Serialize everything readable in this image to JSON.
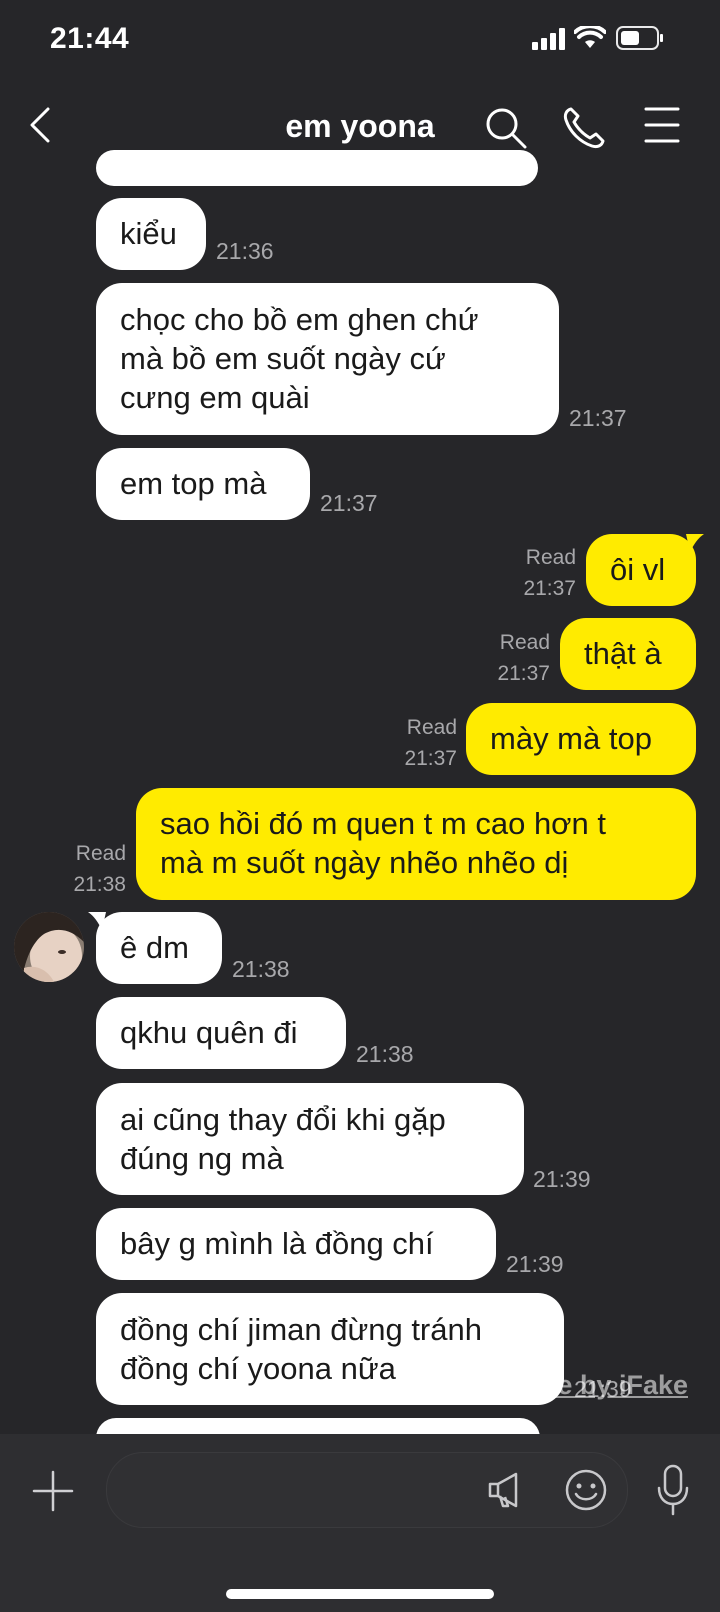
{
  "status_bar": {
    "time": "21:44"
  },
  "header": {
    "title": "em yoona"
  },
  "messages": [
    {
      "text": "kiểu",
      "time": "21:36"
    },
    {
      "text": "chọc cho bồ em ghen chứ\nmà bồ em suốt ngày cứ\ncưng em quài",
      "time": "21:37"
    },
    {
      "text": "em top mà",
      "time": "21:37"
    },
    {
      "text": "ôi vl",
      "time": "21:37",
      "read": "Read"
    },
    {
      "text": "thật à",
      "time": "21:37",
      "read": "Read"
    },
    {
      "text": "mày mà top",
      "time": "21:37",
      "read": "Read"
    },
    {
      "text": "sao hồi đó m quen t m cao hơn t\nmà m suốt ngày nhẽo nhẽo dị",
      "time": "21:38",
      "read": "Read"
    },
    {
      "text": "ê dm",
      "time": "21:38"
    },
    {
      "text": "qkhu quên đi",
      "time": "21:38"
    },
    {
      "text": "ai cũng thay đổi khi gặp\nđúng ng mà",
      "time": "21:39"
    },
    {
      "text": "bây g mình là đồng chí",
      "time": "21:39"
    },
    {
      "text": "đồng chí jiman đừng tránh\nđồng chí yoona nữa",
      "time": "21:39"
    }
  ],
  "watermark": "Made by iFake",
  "colors": {
    "background": "#262629",
    "incoming": "#ffffff",
    "outgoing": "#ffeb00",
    "meta": "#a8a8ab"
  }
}
